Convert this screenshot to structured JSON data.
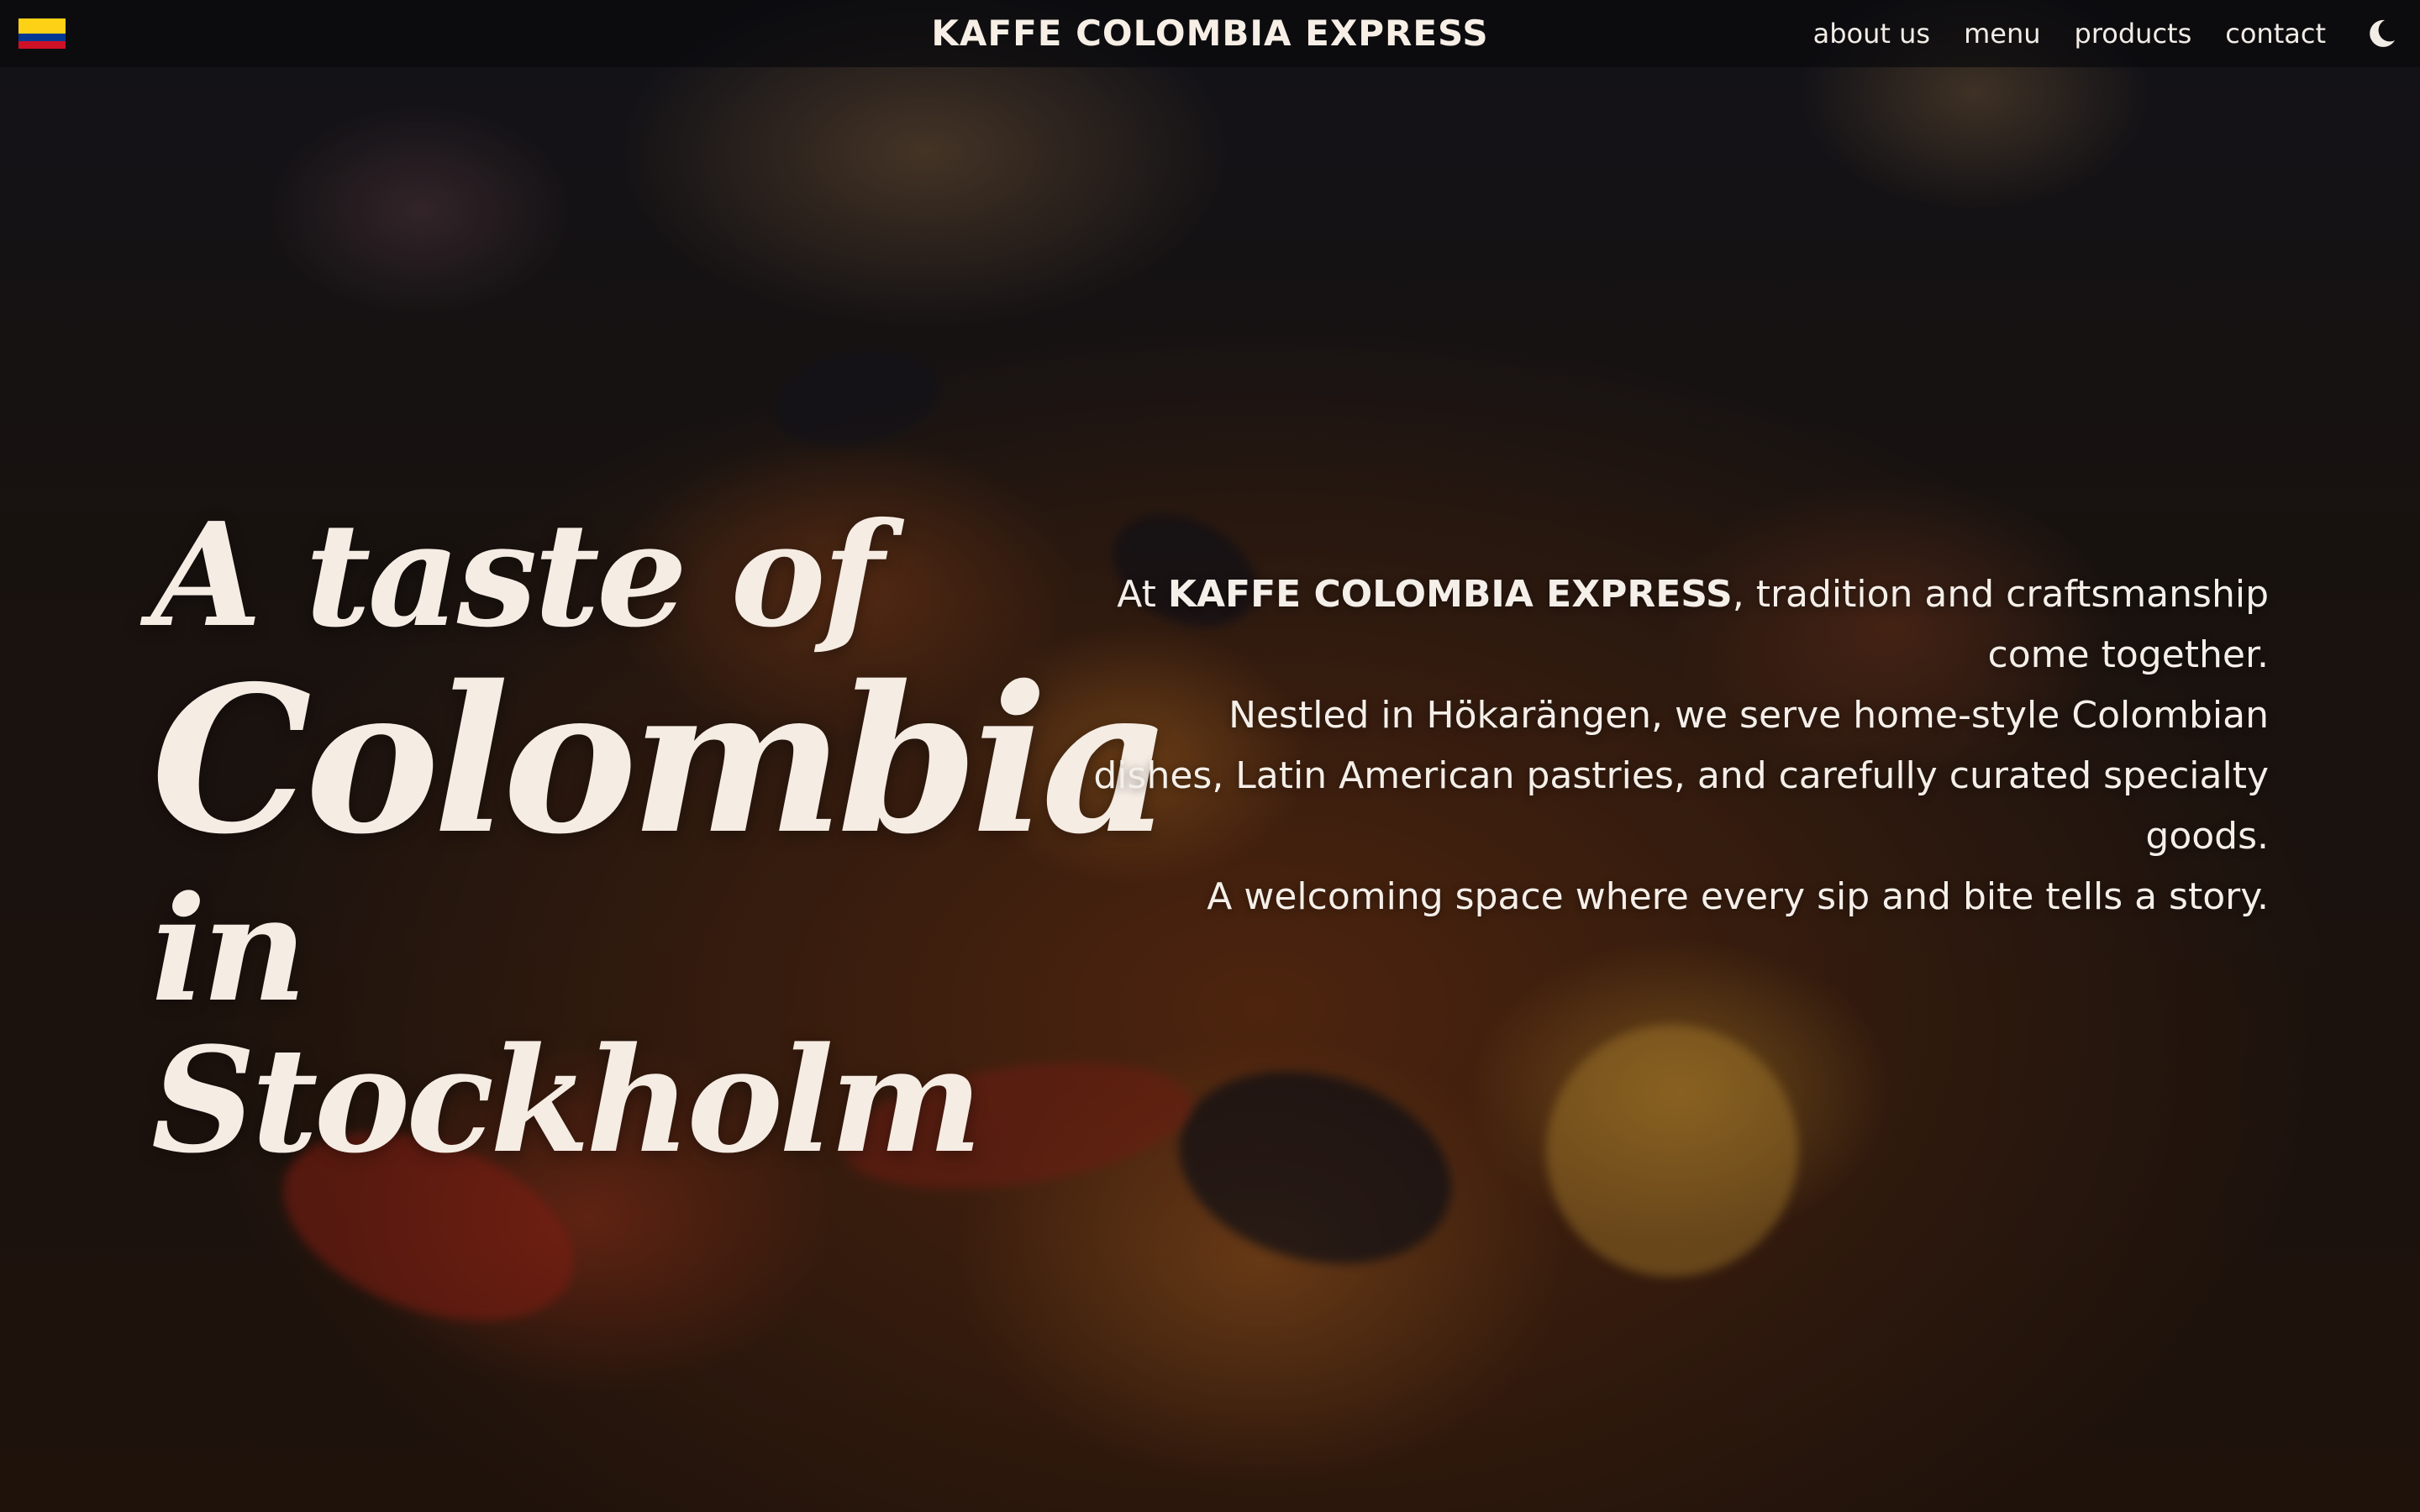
{
  "header": {
    "brand": "KAFFE COLOMBIA EXPRESS",
    "flag_icon": "colombia-flag-icon",
    "theme_toggle_icon": "moon-icon",
    "nav": [
      {
        "label": "about us"
      },
      {
        "label": "menu"
      },
      {
        "label": "products"
      },
      {
        "label": "contact"
      }
    ]
  },
  "hero": {
    "headline_line1": "A taste of",
    "headline_line2": "Colombia",
    "headline_line3": "in Stockholm",
    "intro_prefix": "At ",
    "intro_brand": "KAFFE COLOMBIA EXPRESS",
    "intro_suffix": ", tradition and craftsmanship come together.",
    "intro_line2": "Nestled in Hökarängen, we serve home-style Colombian dishes, Latin American pastries, and carefully curated specialty goods.",
    "intro_line3": "A welcoming space where every sip and bite tells a story."
  },
  "colors": {
    "flag_yellow": "#fcd116",
    "flag_blue": "#003893",
    "flag_red": "#ce1126",
    "text_cream": "#f5ece4"
  }
}
